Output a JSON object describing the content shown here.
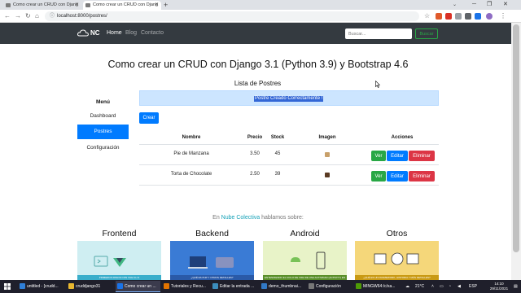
{
  "browser": {
    "tabs": [
      {
        "title": "Como crear un CRUD con Djang"
      },
      {
        "title": "Como crear un CRUD con Djang"
      }
    ],
    "url": "localhost:8000/postres/"
  },
  "navbar": {
    "brand": "NC",
    "links": [
      "Home",
      "Blog",
      "Contacto"
    ],
    "search_placeholder": "Buscar...",
    "search_button": "Buscar"
  },
  "page": {
    "title": "Como crear un CRUD con Django 3.1 (Python 3.9) y Bootstrap 4.6",
    "list_title": "Lista de Postres",
    "alert": "Postre Creado Correctamente !",
    "create_button": "Crear"
  },
  "sidebar": {
    "title": "Menú",
    "items": [
      {
        "label": "Dashboard"
      },
      {
        "label": "Postres"
      },
      {
        "label": "Configuración"
      }
    ]
  },
  "table": {
    "headers": [
      "Nombre",
      "Precio",
      "Stock",
      "Imagen",
      "Acciones"
    ],
    "rows": [
      {
        "nombre": "Pie de Manzana",
        "precio": "3.50",
        "stock": "45",
        "thumb_color": "#c8a06a"
      },
      {
        "nombre": "Torta de Chocolate",
        "precio": "2.50",
        "stock": "39",
        "thumb_color": "#5a3a22"
      }
    ],
    "actions": {
      "ver": "Ver",
      "editar": "Editar",
      "eliminar": "Eliminar"
    }
  },
  "promo": {
    "prefix": "En ",
    "brand": "Nube Colectiva",
    "suffix": " hablamos sobre:"
  },
  "categories": [
    {
      "title": "Frontend",
      "color": "#cfeef2",
      "banner": "PRIMEROS PASOS CON VUE CLI 3",
      "banner_color": "#3aaecb"
    },
    {
      "title": "Backend",
      "color": "#3a7bd5",
      "banner": "¿QUÉ ES PHP Y OTROS DETALLES?",
      "banner_color": "#2a5aa8"
    },
    {
      "title": "Android",
      "color": "#e8f3c8",
      "banner": "ENTENDIENDO EL CICLO DE VIDA DE UNA ACTIVIDAD (ACTIVITY) EN ANDROID",
      "banner_color": "#5a8f2a"
    },
    {
      "title": "Otros",
      "color": "#f5d77a",
      "banner": "¿QUÉ ES UN FRAMEWORK, HISTORIA Y MÁS DETALLES?",
      "banner_color": "#c99a14"
    }
  ],
  "taskbar": {
    "apps": [
      {
        "label": "untitled - [crudd...",
        "color": "#2f7fd8"
      },
      {
        "label": "cruddjango31",
        "color": "#e8b730"
      },
      {
        "label": "Como crear un ...",
        "color": "#1a73e8"
      },
      {
        "label": "Tutoriales y Recu...",
        "color": "#e37400"
      },
      {
        "label": "Editar la entrada ...",
        "color": "#3c8dbc"
      },
      {
        "label": "demo_thumbnai...",
        "color": "#3178c6"
      },
      {
        "label": "Configuración",
        "color": "#777777"
      },
      {
        "label": "MINGW64:/c/xa...",
        "color": "#4e9a06"
      }
    ],
    "temperature": "21°C",
    "language": "ESP",
    "time": "14:10",
    "date": "29/11/2021"
  }
}
